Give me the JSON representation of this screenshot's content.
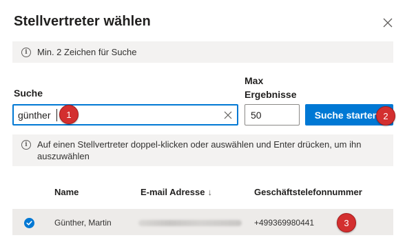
{
  "dialog": {
    "title": "Stellvertreter wählen",
    "info_text": "Min. 2 Zeichen für Suche",
    "search_label": "Suche",
    "max_label": "Max Ergebnisse",
    "search_value": "günther",
    "max_value": "50",
    "search_button": "Suche starten",
    "hint_text": "Auf einen Stellvertreter doppel-klicken oder auswählen und Enter drücken, um ihn auszuwählen"
  },
  "table": {
    "columns": [
      "Name",
      "E-mail Adresse",
      "Geschäftstelefonnummer"
    ],
    "sort_indicator": "↓",
    "rows": [
      {
        "name": "Günther, Martin",
        "email": "",
        "phone": "+499369980441",
        "selected": true
      }
    ]
  },
  "markers": [
    "1",
    "2",
    "3"
  ],
  "colors": {
    "accent": "#0078d4",
    "marker": "#d32f2f",
    "panel": "#f3f2f1",
    "selected_row": "#edebe9"
  }
}
